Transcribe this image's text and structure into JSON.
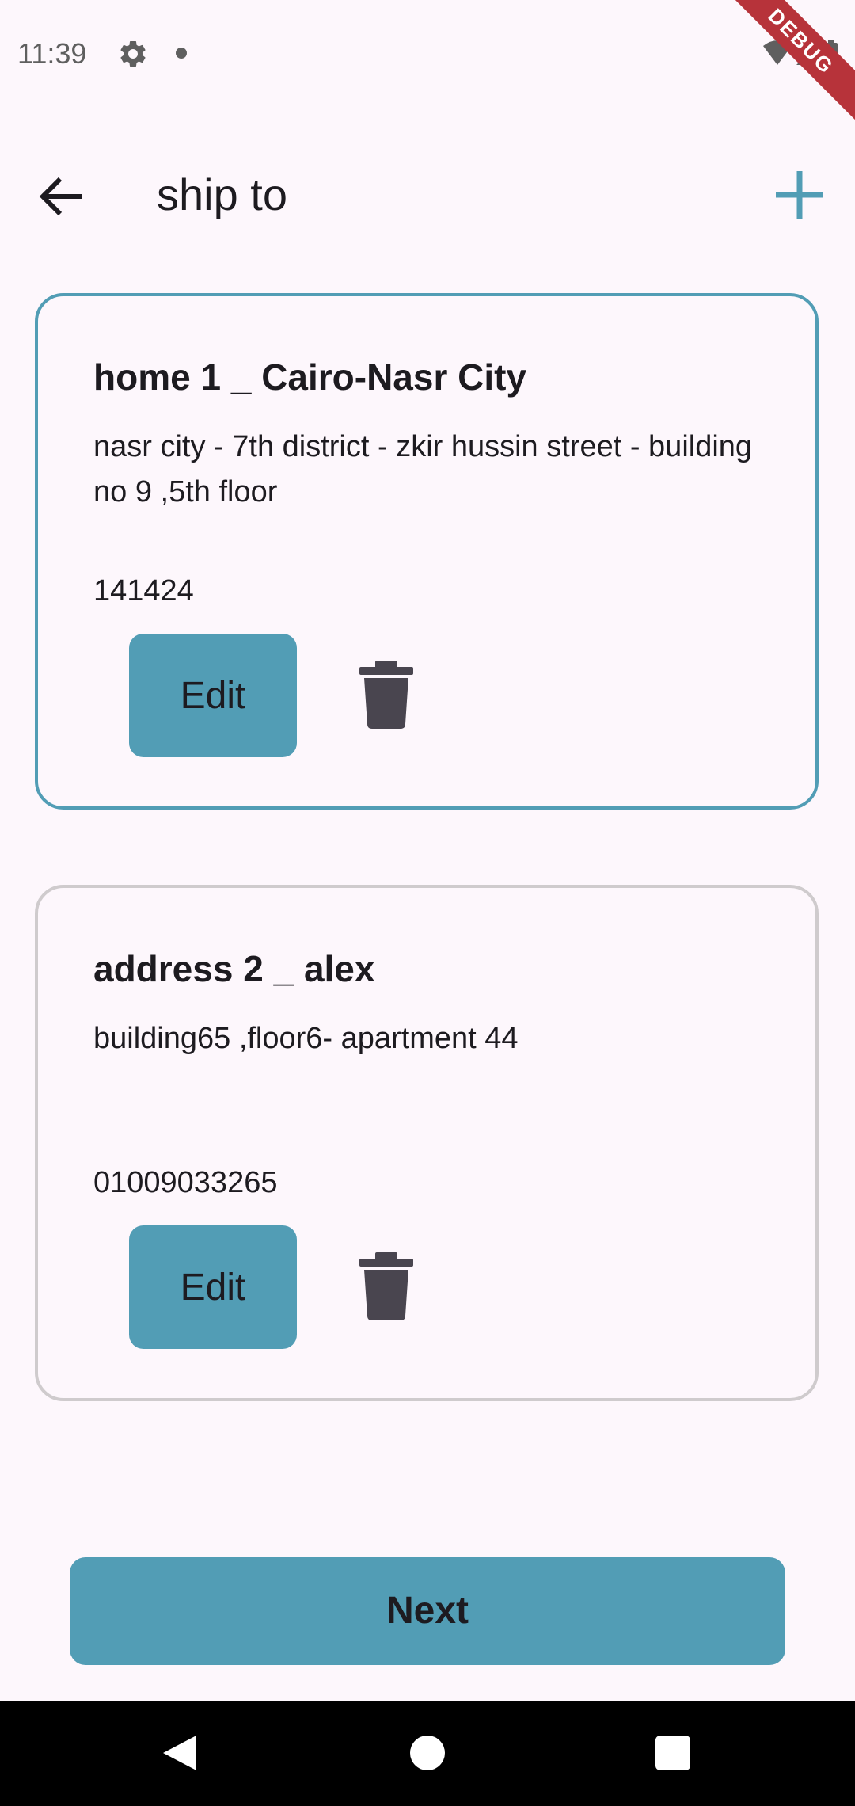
{
  "status_bar": {
    "time": "11:39",
    "icons": [
      "gear-icon",
      "notification-dot-icon",
      "wifi-icon",
      "signal-icon",
      "battery-icon"
    ],
    "debug_label": "DEBUG"
  },
  "app_bar": {
    "title": "ship to",
    "back_icon": "arrow-back-icon",
    "add_icon": "plus-icon"
  },
  "addresses": [
    {
      "title": "home 1 _ Cairo-Nasr City",
      "address": "nasr city - 7th district - zkir hussin street - building no 9 ,5th floor",
      "phone": "141424",
      "edit_label": "Edit",
      "selected": true
    },
    {
      "title": "address 2 _ alex",
      "address": "building65 ,floor6- apartment 44",
      "phone": "01009033265",
      "edit_label": "Edit",
      "selected": false
    }
  ],
  "next_label": "Next",
  "colors": {
    "accent": "#529DB5",
    "background": "#FDF7FC",
    "unselected_border": "#CFCBCD",
    "icon_dark": "#49454F",
    "text": "#1D1B20"
  },
  "nav_bar": {
    "icons": [
      "nav-back-icon",
      "nav-home-icon",
      "nav-recents-icon"
    ]
  }
}
